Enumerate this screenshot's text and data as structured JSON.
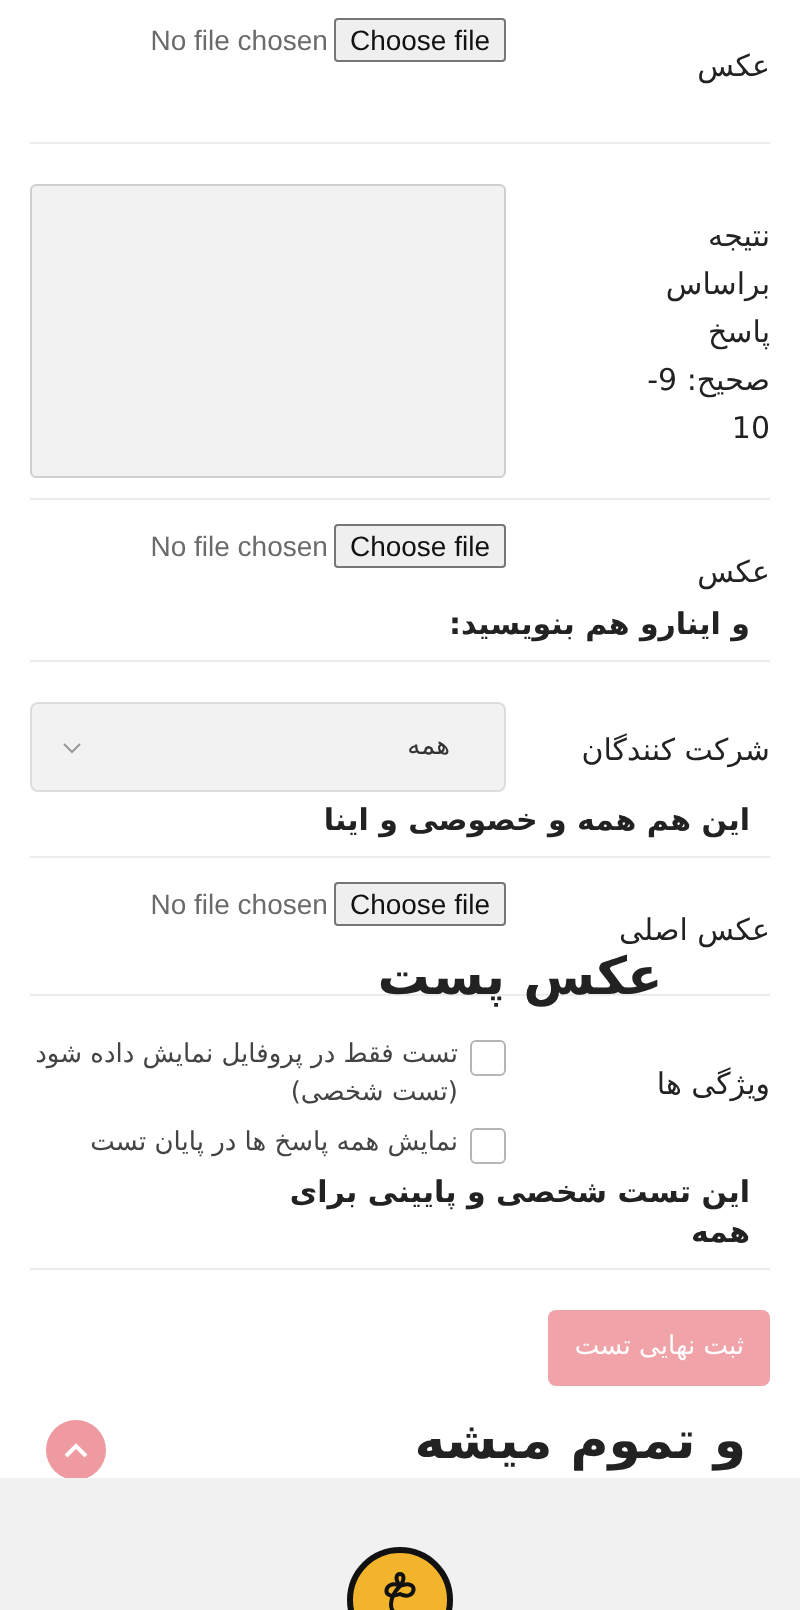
{
  "form": {
    "rows": [
      {
        "kind": "file",
        "label": "عکس",
        "file_status": "No file chosen",
        "button": "Choose file"
      },
      {
        "kind": "textarea",
        "label": "نتیجه براساس پاسخ صحیح: 9-10"
      },
      {
        "kind": "file",
        "label": "عکس",
        "file_status": "No file chosen",
        "button": "Choose file",
        "note": "و اینارو هم بنویسید:"
      },
      {
        "kind": "select",
        "label": "شرکت کنندگان",
        "value": "همه",
        "note": "این هم همه و خصوصی و اینا"
      },
      {
        "kind": "file",
        "label": "عکس اصلی",
        "file_status": "No file chosen",
        "button": "Choose file",
        "note": "عکس پست",
        "note_large": true
      },
      {
        "kind": "checkboxes",
        "label": "ویژگی ها",
        "options": [
          {
            "label": "تست فقط در پروفایل نمایش داده شود (تست شخصی)",
            "checked": false
          },
          {
            "label": "نمایش همه پاسخ ها در پایان تست",
            "checked": false
          }
        ],
        "note": "این تست شخصی و پایینی برای همه"
      }
    ],
    "submit_button": "ثبت نهایی تست"
  },
  "closing_note": "و تموم میشه"
}
